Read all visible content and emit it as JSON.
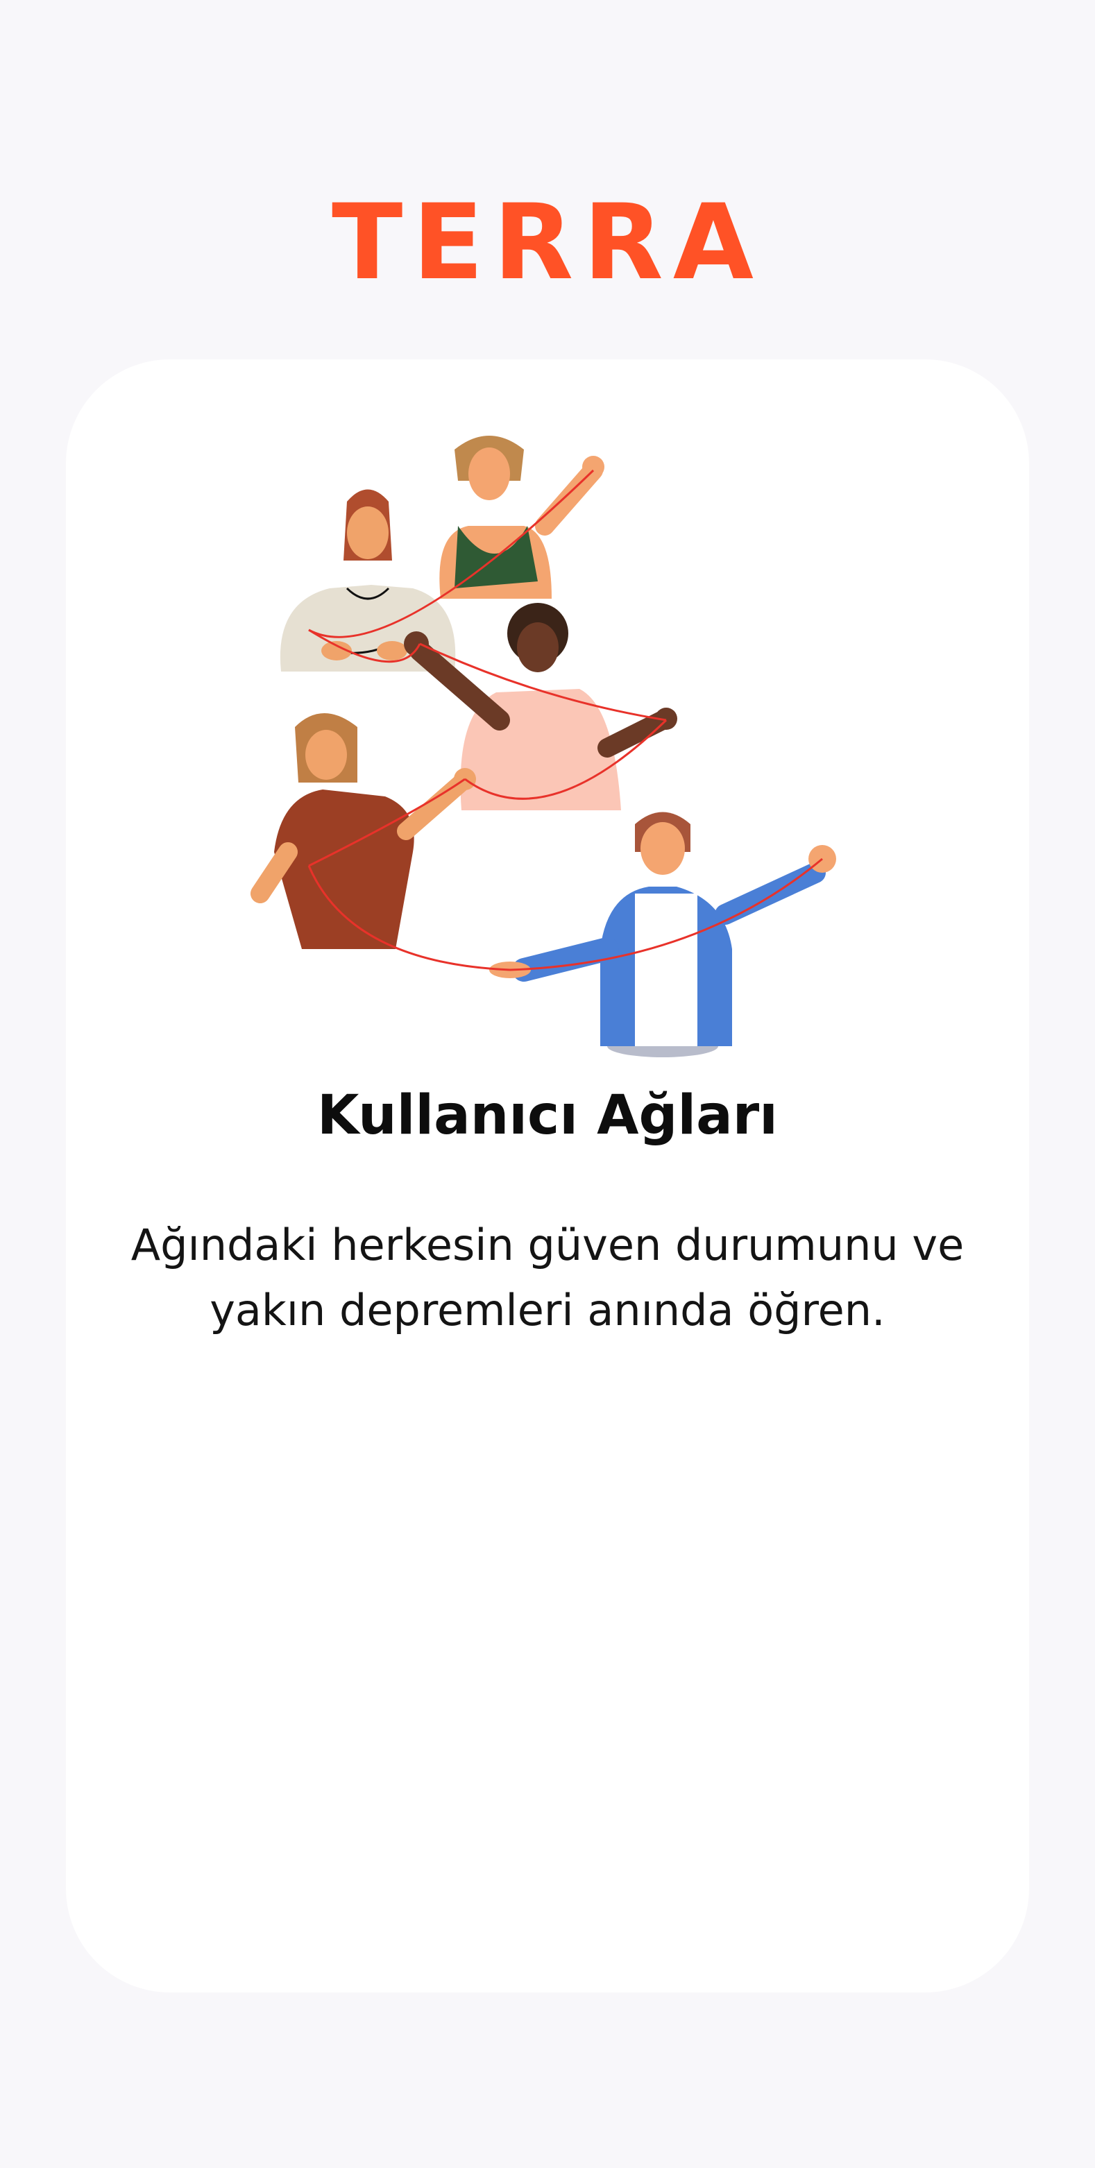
{
  "app": {
    "brand": "TERRA",
    "brand_color": "#ff5226"
  },
  "onboarding": {
    "illustration_icon": "people-holding-red-string-illustration",
    "title": "Kullanıcı Ağları",
    "description": "Ağındaki herkesin güven durumunu ve yakın depremleri anında öğren."
  }
}
